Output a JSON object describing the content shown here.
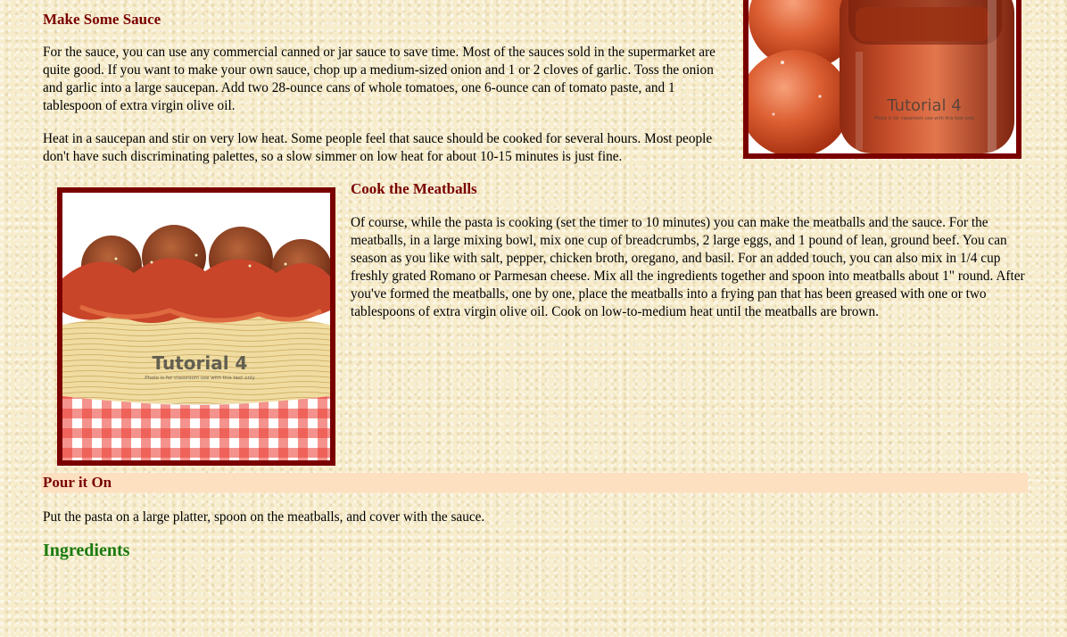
{
  "sauce": {
    "heading": "Make Some Sauce",
    "para1": "For the sauce, you can use any commercial canned or jar sauce to save time. Most of the sauces sold in the supermarket are quite good. If you want to make your own sauce, chop up a medium-sized onion and 1 or 2 cloves of garlic. Toss the onion and garlic into a large saucepan. Add two 28-ounce cans of whole tomatoes, one 6-ounce can of tomato paste, and 1 tablespoon of extra virgin olive oil.",
    "para2": "Heat in a saucepan and stir on very low heat. Some people feel that sauce should be cooked for several hours. Most people don't have such discriminating palettes, so a slow simmer on low heat for about 10-15 minutes is just fine.",
    "image": {
      "watermark": "Tutorial 4",
      "watermark_note": "Photo is for classroom use with this text only"
    }
  },
  "meatballs": {
    "heading": "Cook the Meatballs",
    "para": "Of course, while the pasta is cooking (set the timer to 10 minutes) you can make the meatballs and the sauce. For the meatballs, in a large mixing bowl, mix one cup of breadcrumbs, 2 large eggs, and 1 pound of lean, ground beef. You can season as you like with salt, pepper, chicken broth, oregano, and basil. For an added touch, you can also mix in 1/4 cup freshly grated Romano or Parmesan cheese. Mix all the ingredients together and spoon into meatballs about 1\" round. After you've formed the meatballs, one by one, place the meatballs into a frying pan that has been greased with one or two tablespoons of extra virgin olive oil. Cook on low-to-medium heat until the meatballs are brown.",
    "image": {
      "watermark": "Tutorial 4",
      "watermark_note": "Photo is for classroom use with this text only"
    }
  },
  "pour": {
    "heading": "Pour it On",
    "para": "Put the pasta on a large platter, spoon on the meatballs, and cover with the sauce."
  },
  "ingredients": {
    "heading": "Ingredients"
  },
  "colors": {
    "heading": "#7a0000",
    "frame": "#7a0000",
    "ingredients_heading": "#1a7a10",
    "pour_band": "#fde0c0",
    "page_background": "#f7eccb"
  }
}
